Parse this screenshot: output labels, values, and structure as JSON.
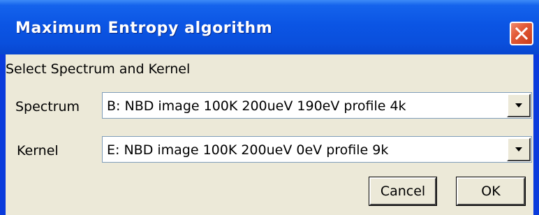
{
  "window": {
    "title": "Maximum Entropy algorithm"
  },
  "dialog": {
    "instruction": "Select Spectrum and Kernel",
    "spectrum": {
      "label": "Spectrum",
      "selected": "B: NBD image 100K 200ueV 190eV profile  4k"
    },
    "kernel": {
      "label": "Kernel",
      "selected": "E: NBD image 100K 200ueV 0eV profile  9k"
    },
    "buttons": {
      "cancel": "Cancel",
      "ok": "OK"
    }
  },
  "icons": {
    "close": "close-icon",
    "dropdown": "chevron-down-icon"
  },
  "colors": {
    "titlebar": "#0a4fdc",
    "close_button": "#e25a37",
    "dialog_background": "#ece9d8"
  }
}
